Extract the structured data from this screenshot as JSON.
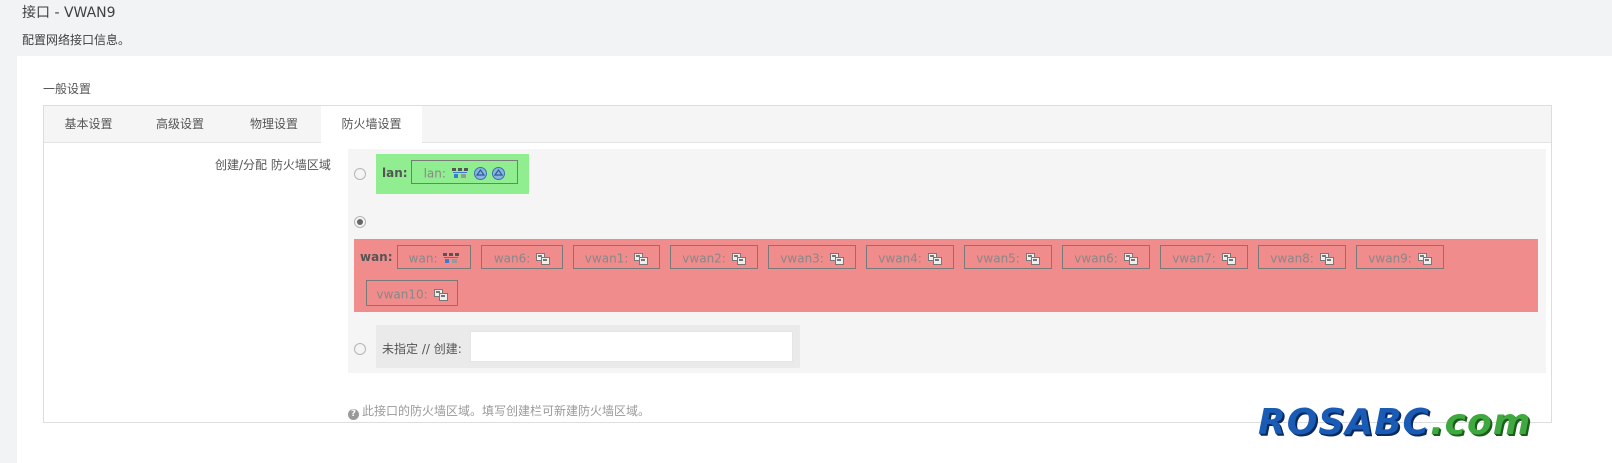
{
  "page": {
    "title": "接口 - VWAN9",
    "description": "配置网络接口信息。"
  },
  "section": {
    "title": "一般设置"
  },
  "tabs": [
    {
      "label": "基本设置",
      "active": false
    },
    {
      "label": "高级设置",
      "active": false
    },
    {
      "label": "物理设置",
      "active": false
    },
    {
      "label": "防火墙设置",
      "active": true
    }
  ],
  "firewall": {
    "field_label": "创建/分配 防火墙区域",
    "zones": [
      {
        "name": "lan:",
        "color": "#90ee90",
        "selected": false,
        "interfaces": [
          {
            "label": "lan:",
            "icons": [
              "network-bridge-icon",
              "wifi-icon",
              "wifi-icon"
            ]
          }
        ]
      },
      {
        "name": "wan:",
        "color": "#f08c8c",
        "selected": true,
        "interfaces": [
          {
            "label": "wan:",
            "icons": [
              "network-bridge-icon"
            ]
          },
          {
            "label": "wan6:",
            "icons": [
              "ethernet-icon"
            ]
          },
          {
            "label": "vwan1:",
            "icons": [
              "ethernet-icon"
            ]
          },
          {
            "label": "vwan2:",
            "icons": [
              "ethernet-icon"
            ]
          },
          {
            "label": "vwan3:",
            "icons": [
              "ethernet-icon"
            ]
          },
          {
            "label": "vwan4:",
            "icons": [
              "ethernet-icon"
            ]
          },
          {
            "label": "vwan5:",
            "icons": [
              "ethernet-icon"
            ]
          },
          {
            "label": "vwan6:",
            "icons": [
              "ethernet-icon"
            ]
          },
          {
            "label": "vwan7:",
            "icons": [
              "ethernet-icon"
            ]
          },
          {
            "label": "vwan8:",
            "icons": [
              "ethernet-icon"
            ]
          },
          {
            "label": "vwan9:",
            "icons": [
              "ethernet-icon"
            ]
          },
          {
            "label": "vwan10:",
            "icons": [
              "ethernet-icon"
            ]
          }
        ]
      }
    ],
    "unassigned": {
      "label": "未指定 // 创建:",
      "selected": false,
      "input_value": "",
      "input_placeholder": ""
    },
    "help_text": "此接口的防火墙区域。填写创建栏可新建防火墙区域。"
  },
  "watermark": {
    "part1": "ROSABC",
    "part2": ".com"
  }
}
